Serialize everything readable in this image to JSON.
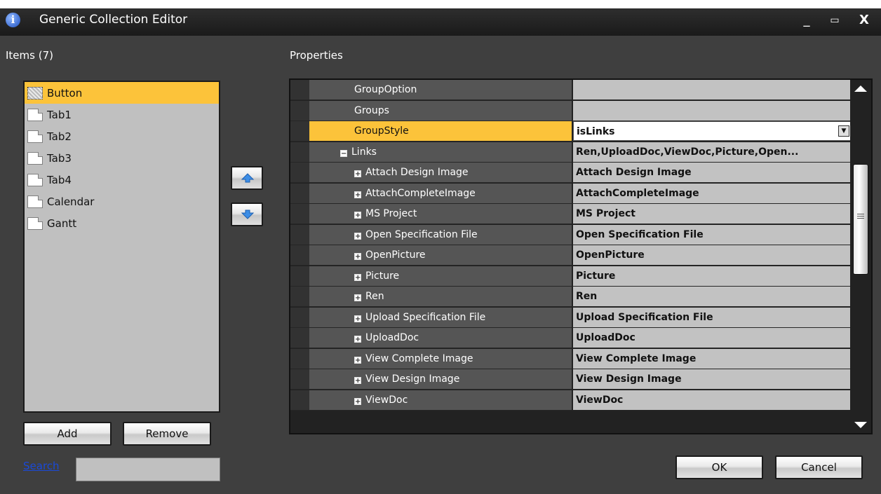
{
  "window": {
    "title": "Generic Collection Editor",
    "icon": "info-icon",
    "controls": {
      "minimize": "_",
      "maximize": "▭",
      "close": "X"
    }
  },
  "items_panel": {
    "label": "Items (7)",
    "items": [
      {
        "label": "Button",
        "selected": true
      },
      {
        "label": "Tab1",
        "selected": false
      },
      {
        "label": "Tab2",
        "selected": false
      },
      {
        "label": "Tab3",
        "selected": false
      },
      {
        "label": "Tab4",
        "selected": false
      },
      {
        "label": "Calendar",
        "selected": false
      },
      {
        "label": "Gantt",
        "selected": false
      }
    ],
    "add_label": "Add",
    "remove_label": "Remove",
    "search_link": "Search",
    "search_value": ""
  },
  "properties_panel": {
    "label": "Properties",
    "rows": [
      {
        "name": "GroupOption",
        "value": "",
        "level": 0,
        "expander": "",
        "selected": false
      },
      {
        "name": "Groups",
        "value": "",
        "level": 0,
        "expander": "",
        "selected": false
      },
      {
        "name": "GroupStyle",
        "value": "isLinks",
        "level": 0,
        "expander": "",
        "selected": true,
        "dropdown": true
      },
      {
        "name": "Links",
        "value": "Ren,UploadDoc,ViewDoc,Picture,Open...",
        "level": 1,
        "expander": "−",
        "selected": false
      },
      {
        "name": "Attach Design Image",
        "value": "Attach Design Image",
        "level": 2,
        "expander": "+",
        "selected": false
      },
      {
        "name": "AttachCompleteImage",
        "value": "AttachCompleteImage",
        "level": 2,
        "expander": "+",
        "selected": false
      },
      {
        "name": "MS Project",
        "value": "MS Project",
        "level": 2,
        "expander": "+",
        "selected": false
      },
      {
        "name": "Open Specification File",
        "value": "Open Specification File",
        "level": 2,
        "expander": "+",
        "selected": false
      },
      {
        "name": "OpenPicture",
        "value": "OpenPicture",
        "level": 2,
        "expander": "+",
        "selected": false
      },
      {
        "name": "Picture",
        "value": "Picture",
        "level": 2,
        "expander": "+",
        "selected": false
      },
      {
        "name": "Ren",
        "value": "Ren",
        "level": 2,
        "expander": "+",
        "selected": false
      },
      {
        "name": "Upload Specification File",
        "value": "Upload Specification File",
        "level": 2,
        "expander": "+",
        "selected": false
      },
      {
        "name": "UploadDoc",
        "value": "UploadDoc",
        "level": 2,
        "expander": "+",
        "selected": false
      },
      {
        "name": "View Complete Image",
        "value": "View Complete Image",
        "level": 2,
        "expander": "+",
        "selected": false
      },
      {
        "name": "View Design Image",
        "value": "View Design Image",
        "level": 2,
        "expander": "+",
        "selected": false
      },
      {
        "name": "ViewDoc",
        "value": "ViewDoc",
        "level": 2,
        "expander": "+",
        "selected": false
      }
    ]
  },
  "footer": {
    "ok_label": "OK",
    "cancel_label": "Cancel"
  },
  "colors": {
    "selection": "#fcc33a",
    "window_bg": "#3f3f3f",
    "list_bg": "#c0c0c0",
    "link": "#1a49d8"
  }
}
